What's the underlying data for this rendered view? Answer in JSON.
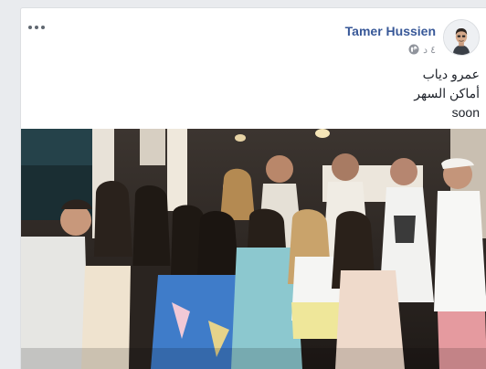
{
  "post": {
    "author": "Tamer Hussien",
    "timestamp": "٤ د",
    "audience_icon": "globe-icon",
    "lines": [
      "عمرو دياب",
      "أماكن السهر",
      "soon"
    ],
    "photo_icon": "group-photo"
  },
  "colors": {
    "author_link": "#385898",
    "meta_text": "#90949c",
    "body_text": "#1d2129",
    "page_bg": "#e9ebee"
  }
}
